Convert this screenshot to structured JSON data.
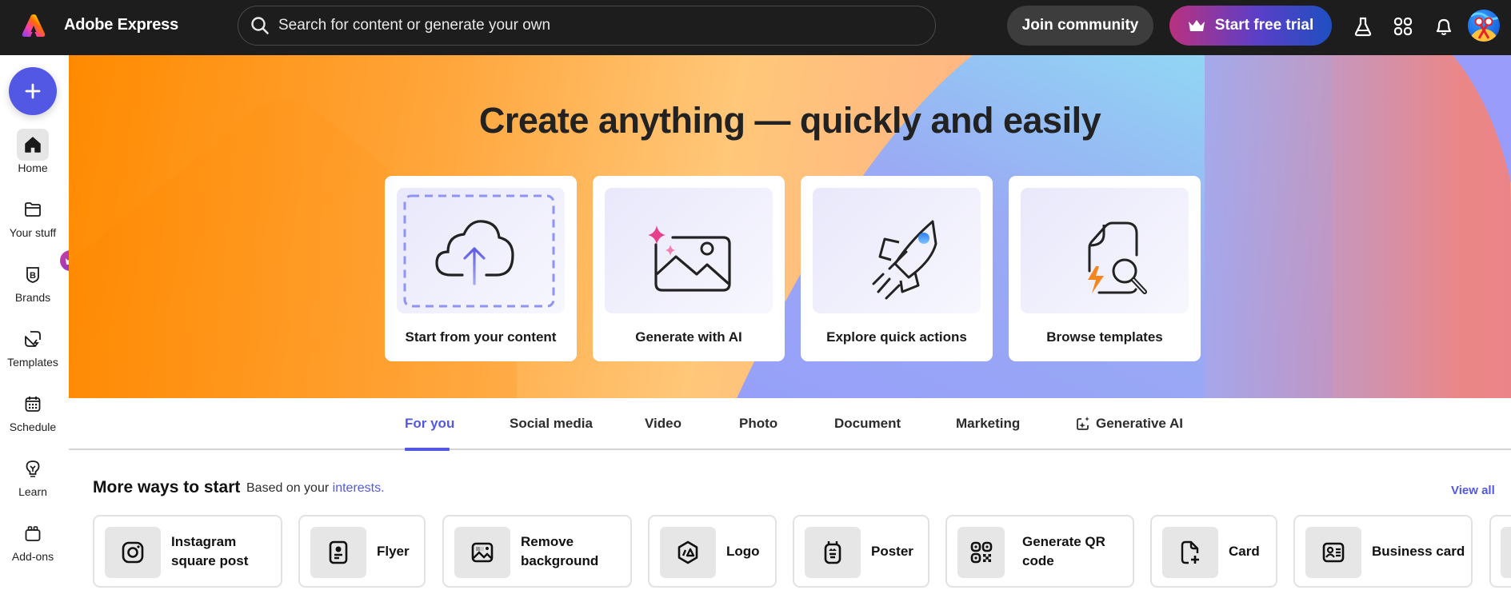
{
  "header": {
    "app_name": "Adobe Express",
    "search_placeholder": "Search for content or generate your own",
    "join_label": "Join community",
    "trial_label": "Start free trial",
    "icons": [
      "labs-flask-icon",
      "apps-grid-icon",
      "notifications-bell-icon",
      "user-avatar"
    ]
  },
  "sidebar": {
    "create_button": "create-new-plus",
    "items": [
      {
        "label": "Home",
        "icon": "home-icon",
        "active": true
      },
      {
        "label": "Your stuff",
        "icon": "folder-icon"
      },
      {
        "label": "Brands",
        "icon": "brand-icon",
        "badge": "premium-crown"
      },
      {
        "label": "Templates",
        "icon": "templates-icon"
      },
      {
        "label": "Schedule",
        "icon": "calendar-icon"
      },
      {
        "label": "Learn",
        "icon": "lightbulb-icon"
      },
      {
        "label": "Add-ons",
        "icon": "addons-icon"
      }
    ]
  },
  "hero": {
    "title": "Create anything — quickly and easily",
    "cards": [
      {
        "label": "Start from your content",
        "icon": "cloud-upload-icon"
      },
      {
        "label": "Generate with AI",
        "icon": "ai-image-icon"
      },
      {
        "label": "Explore quick actions",
        "icon": "rocket-icon"
      },
      {
        "label": "Browse templates",
        "icon": "template-search-icon"
      }
    ]
  },
  "tabs": [
    {
      "label": "For you",
      "active": true
    },
    {
      "label": "Social media"
    },
    {
      "label": "Video"
    },
    {
      "label": "Photo"
    },
    {
      "label": "Document"
    },
    {
      "label": "Marketing"
    },
    {
      "label": "Generative AI",
      "icon": "generative-ai-icon"
    }
  ],
  "more_ways": {
    "title": "More ways to start",
    "subtitle_prefix": "Based on your",
    "subtitle_link": "interests.",
    "view_all": "View all",
    "items": [
      {
        "label": "Instagram square post",
        "icon": "instagram-icon"
      },
      {
        "label": "Flyer",
        "icon": "flyer-icon"
      },
      {
        "label": "Remove background",
        "icon": "remove-background-icon"
      },
      {
        "label": "Logo",
        "icon": "logo-icon"
      },
      {
        "label": "Poster",
        "icon": "poster-icon"
      },
      {
        "label": "Generate QR code",
        "icon": "qr-code-icon"
      },
      {
        "label": "Card",
        "icon": "card-icon"
      },
      {
        "label": "Business card",
        "icon": "business-card-icon"
      }
    ]
  },
  "colors": {
    "accent": "#5258e4",
    "header_bg": "#1d1d1d",
    "hero_orange": "#ff8a00",
    "hero_blue": "#97a2f9"
  }
}
